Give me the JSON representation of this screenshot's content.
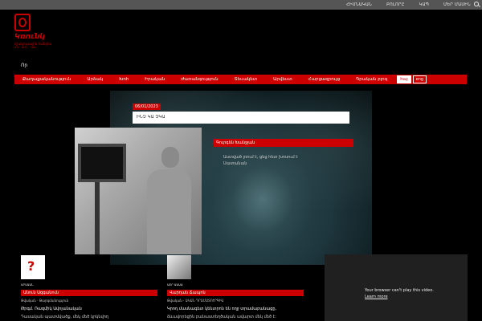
{
  "topbar": {
    "links": [
      "ՀԻՄՆԱԿԱՆ",
      "ԲՈԼՈՐԸ",
      "ԿԱՊ",
      "ՄԵՐ ՄԱՍԻՆ"
    ],
    "search_icon": "search-icon"
  },
  "logo": {
    "name": "Կռունկ",
    "tagline": "մշակութային հանդես",
    "year": "ՀՄ · ԱՄՆ · ԿԱՆ"
  },
  "search_label": "Որ",
  "nav": {
    "items": [
      "Քաղաքականություն",
      "Արձակ",
      "Խոհ",
      "Իրական",
      "Ժառանգություն",
      "Տեսակետ",
      "Արվեստ",
      "Հարցազրույց",
      "Գրական բլոգ"
    ],
    "lang_active": "հայ",
    "lang_inactive": "eng"
  },
  "hero": {
    "date": "06/01/2023",
    "title": "ԻՆՉ ԿԱ ՉԿԱ",
    "author": "Գուրգեն Խանջյան",
    "text": "Աստված լռում է, ցեց հետ խոսում է Սատանան"
  },
  "cards": [
    {
      "meta": "ԱՐԱԱԱՆ",
      "author": "Անուն Ազգանուն",
      "subtitle": "Թվական · Թարգմանություն",
      "desc": "Թրգմ. Ռազմիկ Ավոյանական",
      "desc2": "Դասական պատմվածք, մեկ մեծ կրկնվող"
    },
    {
      "meta": "ԱԲՐ ԱԱԱԱ",
      "author": "Վարդան Ճապոն",
      "subtitle": "Թվական · ԱԿԱՆ ԴՐԱՄԱՏՈՒՐԳԻԱ",
      "desc": "Կրոդ մասնագետ կենտրոն են ողջ տրամաբանացը,",
      "desc2": "ձևավորեցին բանաստեղծական ավարտ մեկ մեծ է:"
    }
  ],
  "video": {
    "message": "Your browser can't play this video.",
    "link": "Learn more"
  }
}
